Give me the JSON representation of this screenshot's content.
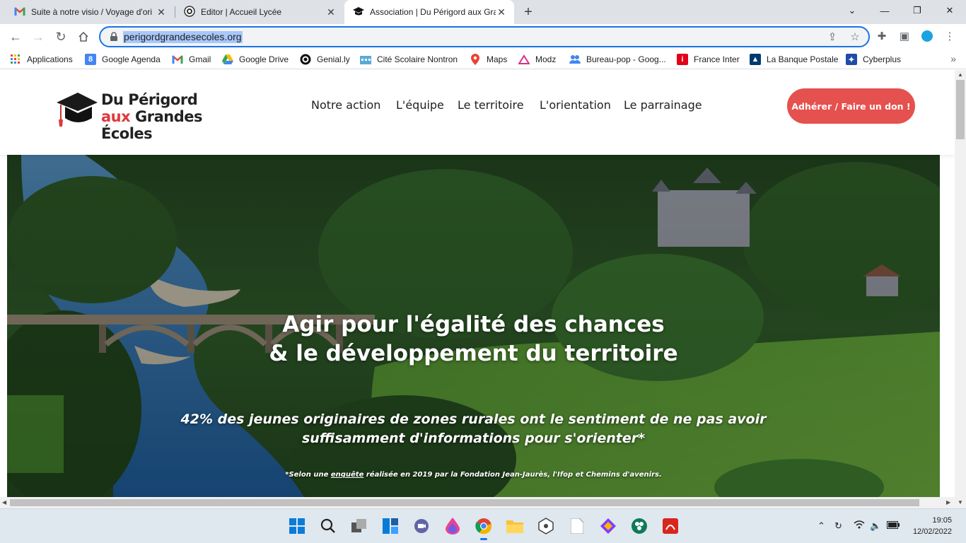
{
  "browser": {
    "tabs": [
      {
        "title": "Suite à notre visio / Voyage d'ori",
        "icon": "gmail-icon"
      },
      {
        "title": "Editor | Accueil Lycée",
        "icon": "google-icon"
      },
      {
        "title": "Association | Du Périgord aux Gra",
        "icon": "graduation-cap-icon"
      }
    ],
    "url": "perigordgrandesecoles.org",
    "bookmarks": [
      "Applications",
      "Google Agenda",
      "Gmail",
      "Google Drive",
      "Genial.ly",
      "Cité Scolaire Nontron",
      "Maps",
      "Modz",
      "Bureau-pop - Goog...",
      "France Inter",
      "La Banque Postale",
      "Cyberplus"
    ]
  },
  "site": {
    "logo": {
      "line1": "Du Périgord",
      "line2a": "aux",
      "line2b": "Grandes Écoles"
    },
    "nav": [
      "Notre action",
      "L'équipe",
      "Le territoire",
      "L'orientation",
      "Le parrainage"
    ],
    "cta": "Adhérer / Faire un don !",
    "hero": {
      "title_line1": "Agir pour l'égalité des chances",
      "title_line2": "& le développement du territoire",
      "subtitle_line1": "42% des jeunes originaires de zones rurales ont le sentiment de ne pas avoir",
      "subtitle_line2": "suffisamment d'informations pour s'orienter*",
      "note_before": "*Selon une ",
      "note_link": "enquête",
      "note_after": " réalisée en 2019 par la Fondation Jean-Jaurès, l'Ifop et Chemins d'avenirs."
    }
  },
  "taskbar": {
    "time": "19:05",
    "date": "12/02/2022"
  },
  "colors": {
    "accent": "#e5514e",
    "chrome_blue": "#1a73e8"
  }
}
